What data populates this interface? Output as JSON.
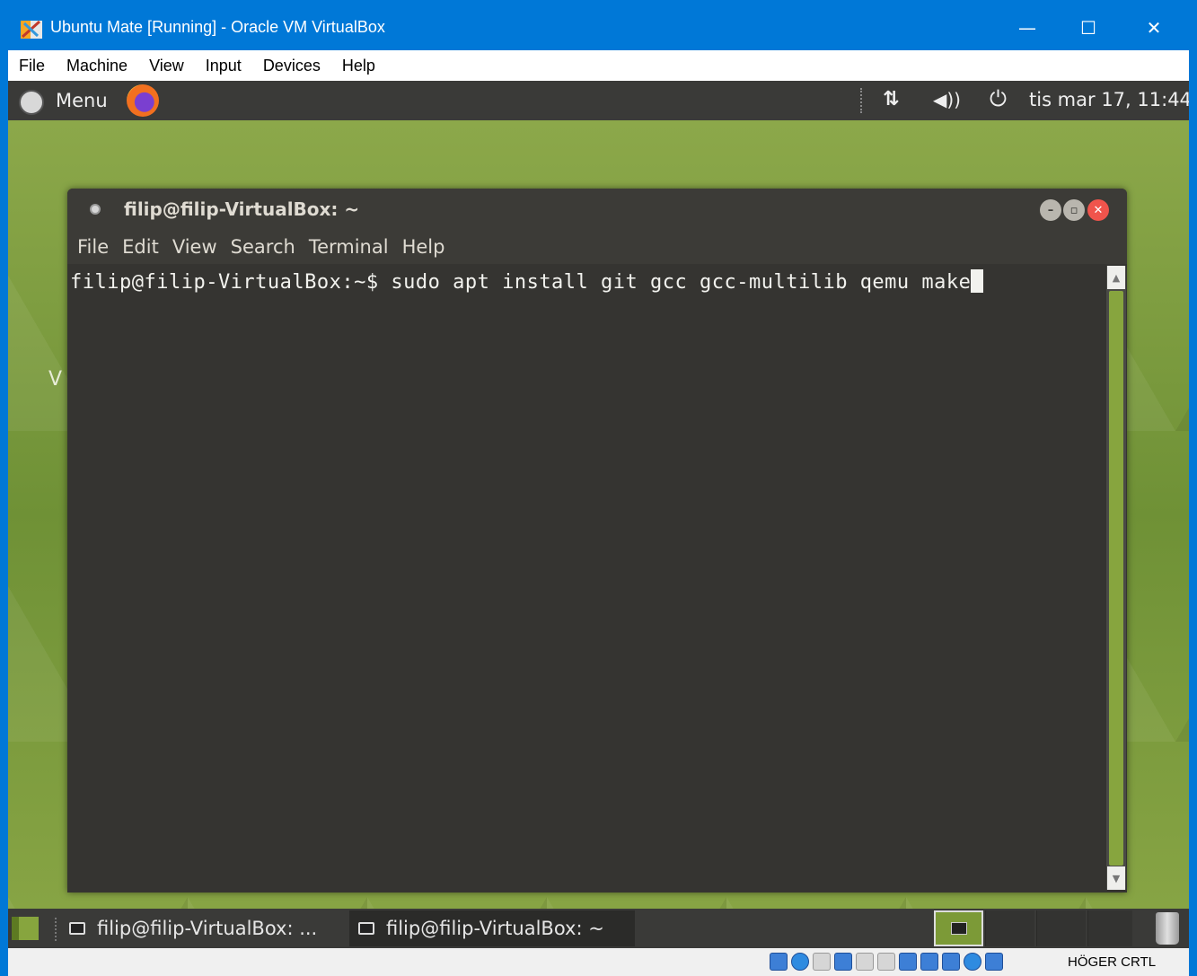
{
  "window": {
    "title": "Ubuntu Mate [Running] - Oracle VM VirtualBox",
    "minimize": "—",
    "maximize": "☐",
    "close": "✕"
  },
  "vbox_menu": [
    "File",
    "Machine",
    "View",
    "Input",
    "Devices",
    "Help"
  ],
  "top_panel": {
    "menu_label": "Menu",
    "network_icon": "⇅",
    "volume_icon": "◀))",
    "power_icon": "⏻",
    "clock": "tis mar 17, 11:44"
  },
  "desktop": {
    "partial_letter": "V"
  },
  "terminal": {
    "title": "filip@filip-VirtualBox: ~",
    "menu": [
      "File",
      "Edit",
      "View",
      "Search",
      "Terminal",
      "Help"
    ],
    "prompt_line": "filip@filip-VirtualBox:~$ sudo apt install git gcc gcc-multilib qemu make"
  },
  "taskbar": {
    "tasks": [
      "filip@filip-VirtualBox: ...",
      "filip@filip-VirtualBox: ~"
    ]
  },
  "statusbar": {
    "host_key": "HÖGER CRTL"
  },
  "colors": {
    "vbox_accent": "#0078d7",
    "panel": "#3a3a38",
    "terminal_bg": "#353431",
    "mate_green": "#87a53e",
    "close_red": "#f0544c"
  }
}
